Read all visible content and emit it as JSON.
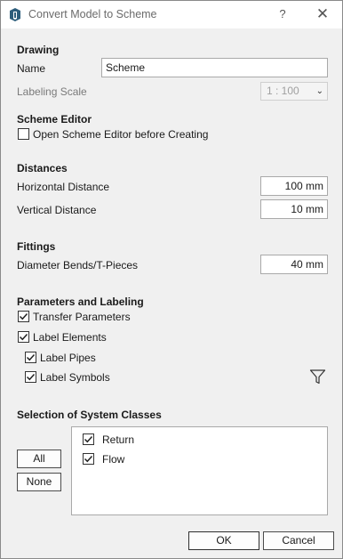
{
  "window": {
    "title": "Convert Model to Scheme",
    "help_label": "?",
    "close_label": "✕"
  },
  "drawing": {
    "header": "Drawing",
    "name_label": "Name",
    "name_value": "Scheme",
    "scale_label": "Labeling Scale",
    "scale_value": "1 : 100"
  },
  "scheme_editor": {
    "header": "Scheme Editor",
    "open_label": "Open Scheme Editor before Creating",
    "open_checked": false
  },
  "distances": {
    "header": "Distances",
    "horizontal_label": "Horizontal Distance",
    "horizontal_value": "100 mm",
    "vertical_label": "Vertical Distance",
    "vertical_value": "10 mm"
  },
  "fittings": {
    "header": "Fittings",
    "diameter_label": "Diameter Bends/T-Pieces",
    "diameter_value": "40 mm"
  },
  "parameters": {
    "header": "Parameters and Labeling",
    "transfer_label": "Transfer Parameters",
    "label_elements_label": "Label Elements",
    "label_pipes_label": "Label Pipes",
    "label_symbols_label": "Label Symbols"
  },
  "system_classes": {
    "header": "Selection of System Classes",
    "all_label": "All",
    "none_label": "None",
    "items": [
      {
        "label": "Return",
        "checked": true
      },
      {
        "label": "Flow",
        "checked": true
      }
    ]
  },
  "footer": {
    "ok_label": "OK",
    "cancel_label": "Cancel"
  },
  "icons": {
    "app": "app-logo-icon",
    "filter": "filter-icon",
    "checkmark": "checkmark-icon"
  }
}
